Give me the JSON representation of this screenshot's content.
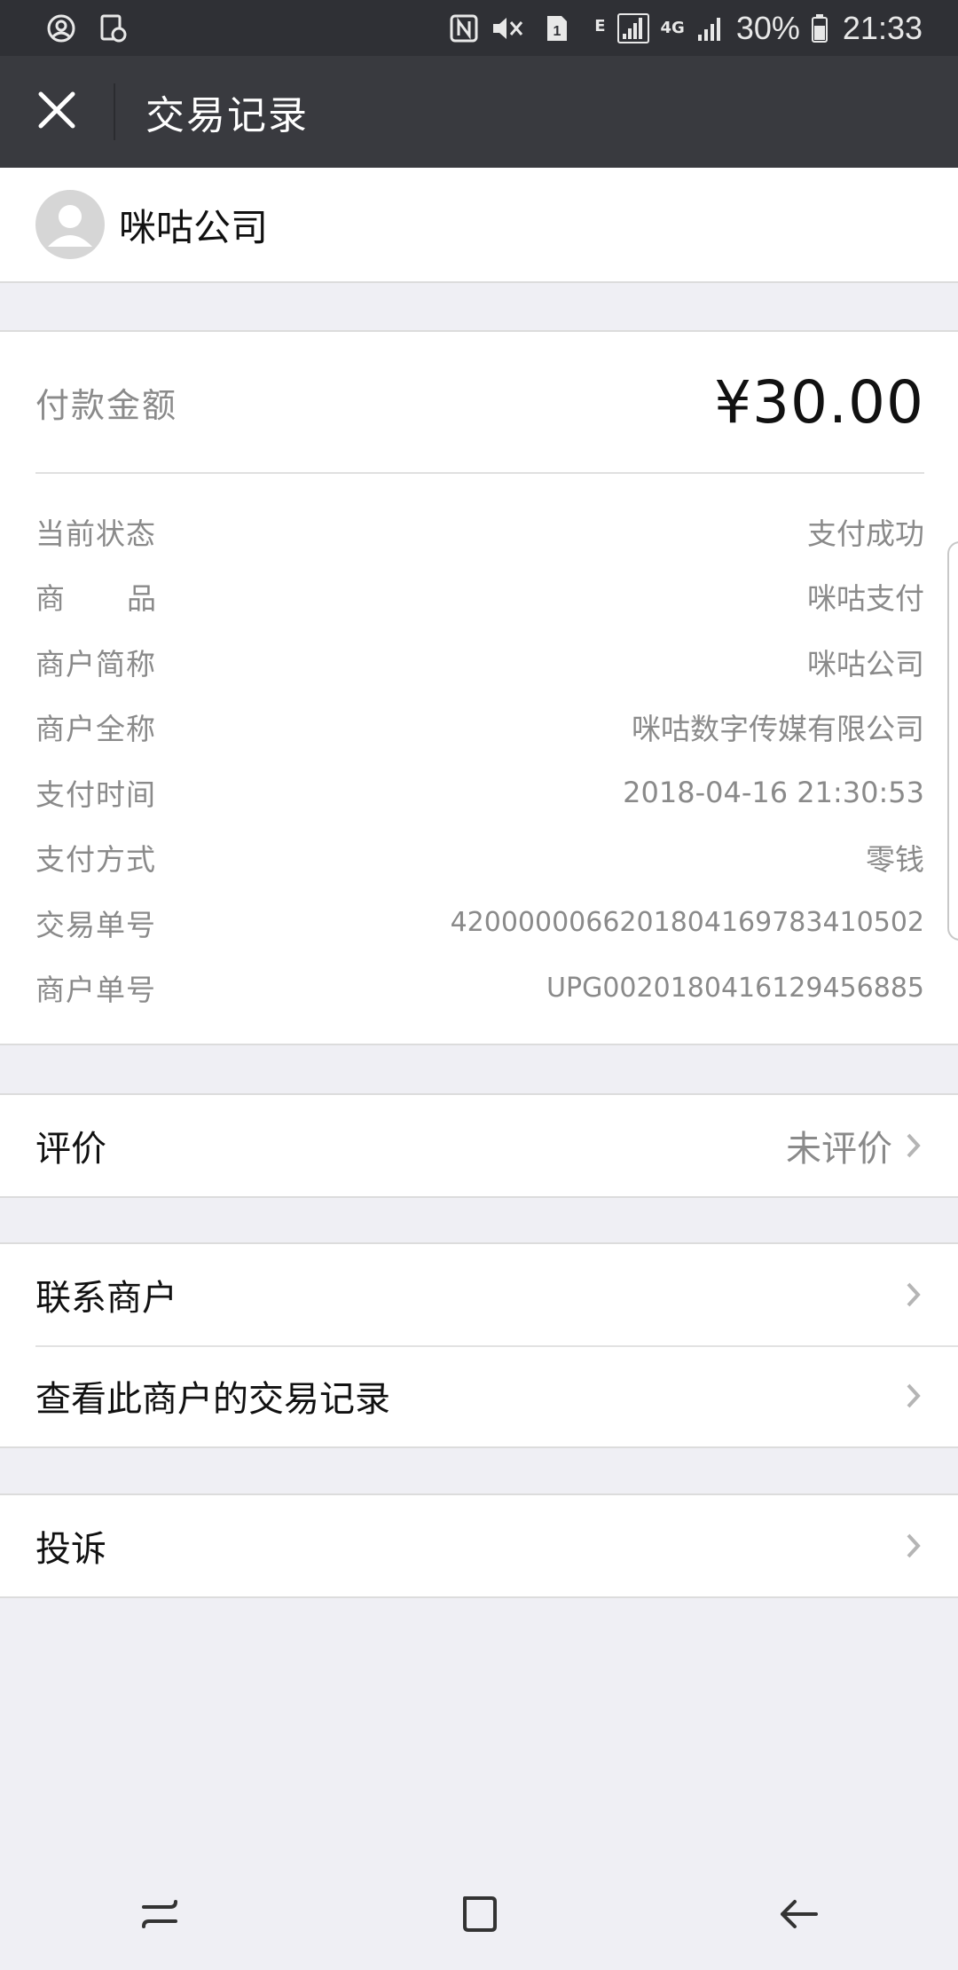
{
  "status_bar": {
    "battery": "30%",
    "time": "21:33",
    "sim_slot": "1",
    "network_e": "E",
    "network_4g": "4G",
    "icons": [
      "account-circle-icon",
      "screen-record-icon",
      "nfc-icon",
      "mute-icon",
      "sim-icon",
      "signal-icon",
      "signal-icon",
      "battery-icon"
    ]
  },
  "header": {
    "title": "交易记录",
    "close_icon": "close-icon"
  },
  "merchant": {
    "name": "咪咕公司",
    "avatar_icon": "user-avatar-icon"
  },
  "payment": {
    "amount_label": "付款金额",
    "amount": "¥30.00",
    "details": [
      {
        "label": "当前状态",
        "value": "支付成功"
      },
      {
        "label": "商      品",
        "value": "咪咕支付"
      },
      {
        "label": "商户简称",
        "value": "咪咕公司"
      },
      {
        "label": "商户全称",
        "value": "咪咕数字传媒有限公司"
      },
      {
        "label": "支付时间",
        "value": "2018-04-16 21:30:53"
      },
      {
        "label": "支付方式",
        "value": "零钱"
      },
      {
        "label": "交易单号",
        "value": "4200000066201804169783410502"
      },
      {
        "label": "商户单号",
        "value": "UPG0020180416129456885"
      }
    ]
  },
  "menu": {
    "rating_label": "评价",
    "rating_value": "未评价",
    "contact_label": "联系商户",
    "history_label": "查看此商户的交易记录",
    "complain_label": "投诉"
  },
  "navbar": {
    "icons": [
      "recent-apps-icon",
      "home-icon",
      "back-icon"
    ]
  },
  "colors": {
    "titlebar_bg": "#393a3f",
    "statusbar_bg": "#2f3035",
    "page_bg": "#efeff4",
    "secondary_text": "#8a8a8a"
  }
}
